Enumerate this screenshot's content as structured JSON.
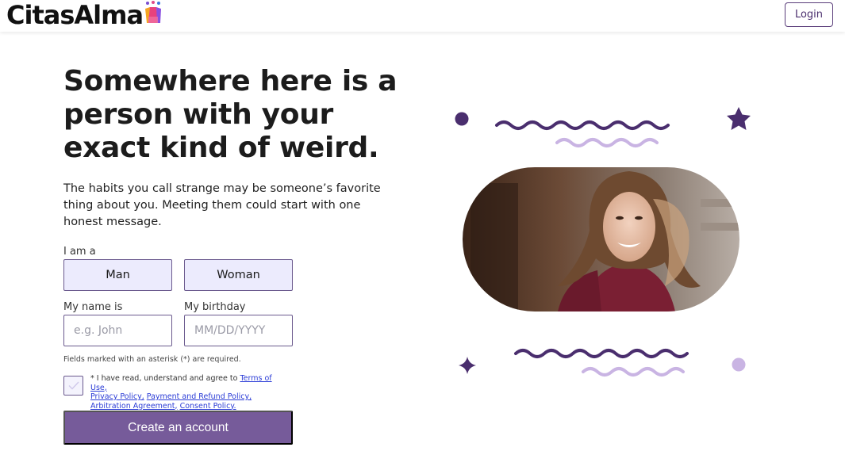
{
  "header": {
    "logo_text": "CitasAlma",
    "logo_icon": "multicolor-people-logo-icon",
    "login_label": "Login"
  },
  "hero": {
    "headline": "Somewhere here is a person with your exact kind of weird.",
    "subtext": "The habits you call strange may be someone’s favorite thing about you. Meeting them could start with one honest message."
  },
  "form": {
    "gender_label": "I am a",
    "gender_options": [
      "Man",
      "Woman"
    ],
    "name_label": "My name is",
    "name_placeholder": "e.g. John",
    "name_value": "",
    "birthday_label": "My birthday",
    "birthday_placeholder": "MM/DD/YYYY",
    "birthday_value": "",
    "required_note": "Fields marked with an asterisk (*) are required.",
    "terms_prefix": "* I have read, understand and agree to ",
    "terms_links": [
      "Terms of Use,",
      "Privacy Policy,",
      "Payment and Refund Policy,",
      "Arbitration Agreement,",
      "Consent Policy."
    ],
    "terms_checked": false,
    "submit_label": "Create an account"
  },
  "colors": {
    "accent": "#765b9a",
    "dark_purple": "#4a2e6e",
    "light_purple": "#c9b4e3",
    "option_bg": "#ecebfd"
  }
}
